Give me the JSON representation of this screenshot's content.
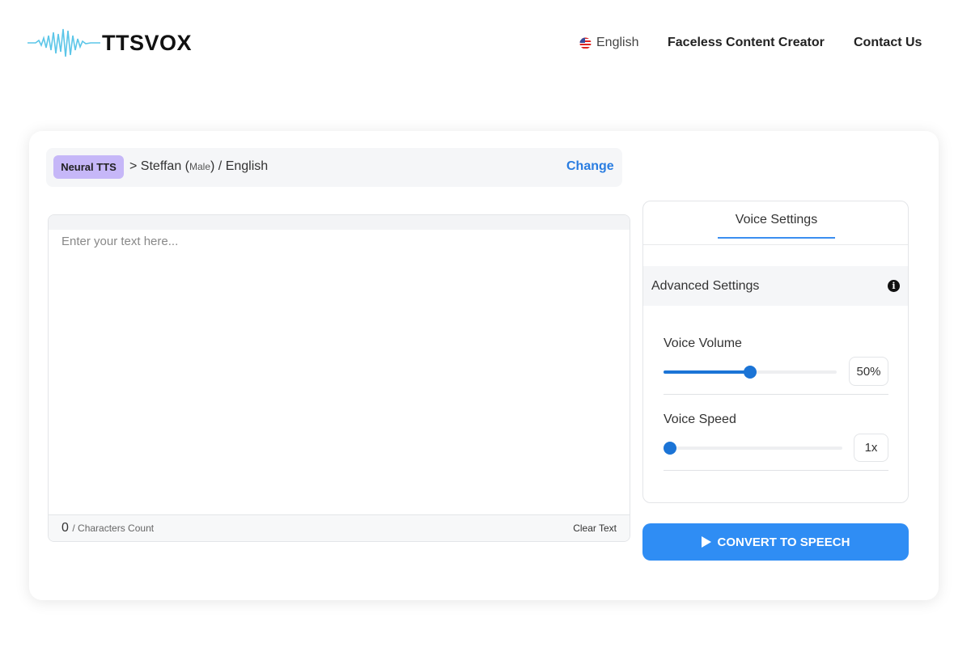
{
  "header": {
    "logo_text": "TTSVOX",
    "nav": {
      "language": "English",
      "faceless": "Faceless Content Creator",
      "contact": "Contact Us"
    }
  },
  "voice": {
    "engine_badge": "Neural TTS",
    "separator": ">",
    "name": "Steffan",
    "gender": "Male",
    "language": "English",
    "change_label": "Change"
  },
  "editor": {
    "placeholder": "Enter your text here...",
    "value": "",
    "char_count": "0",
    "char_count_label": "/ Characters Count",
    "clear_label": "Clear Text"
  },
  "settings": {
    "tab_label": "Voice Settings",
    "advanced_label": "Advanced Settings",
    "volume": {
      "label": "Voice Volume",
      "value": "50%",
      "fraction": 0.5
    },
    "speed": {
      "label": "Voice Speed",
      "value": "1x",
      "fraction": 0.0
    }
  },
  "convert_label": "CONVERT TO SPEECH",
  "colors": {
    "accent": "#2f8df4",
    "slider": "#1b74d6",
    "badge": "#c6b7f8",
    "link": "#2a7de1"
  }
}
